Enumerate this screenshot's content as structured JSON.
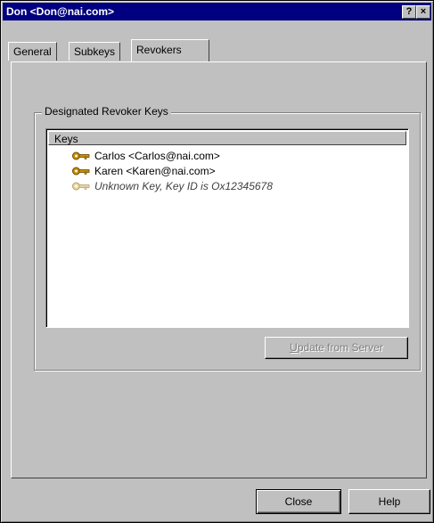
{
  "window": {
    "title": "Don <Don@nai.com>",
    "help_glyph": "?",
    "close_glyph": "×"
  },
  "tabs": [
    {
      "label": "General",
      "active": false
    },
    {
      "label": "Subkeys",
      "active": false
    },
    {
      "label": "Revokers",
      "active": true
    }
  ],
  "group": {
    "label": "Designated Revoker Keys"
  },
  "list": {
    "column_header": "Keys",
    "items": [
      {
        "label": "Carlos <Carlos@nai.com>",
        "icon": "key-icon",
        "status": "known"
      },
      {
        "label": "Karen <Karen@nai.com>",
        "icon": "key-icon",
        "status": "known"
      },
      {
        "label": "Unknown Key, Key ID is Ox12345678",
        "icon": "key-icon",
        "status": "unknown"
      }
    ]
  },
  "update_button": {
    "label_first": "U",
    "label_rest": "pdate from Server",
    "enabled": false
  },
  "footer": {
    "close_label": "Close",
    "help_label": "Help"
  },
  "colors": {
    "title_bar": "#000080",
    "face": "#c0c0c0",
    "key_known": "#c8900c",
    "key_unknown": "#e8d8a0"
  }
}
